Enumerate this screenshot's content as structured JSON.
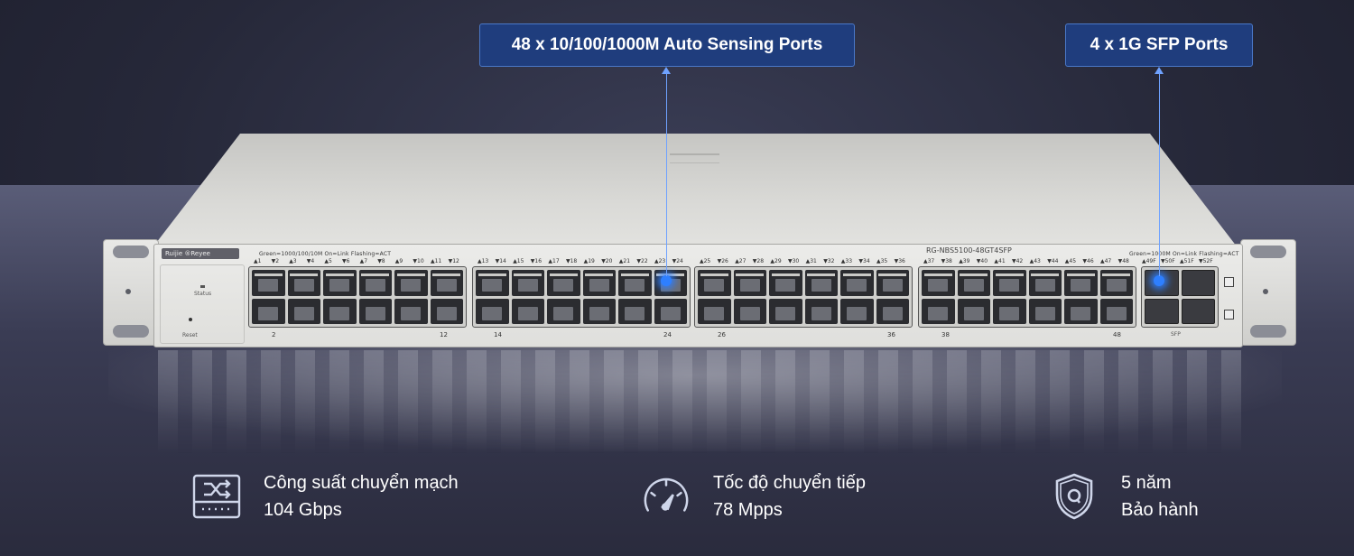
{
  "callouts": {
    "ports_label": "48 x 10/100/1000M Auto Sensing Ports",
    "sfp_label": "4 x 1G SFP Ports"
  },
  "device": {
    "brand": "Ruijie ®Reyee",
    "model": "RG-NBS5100-48GT4SFP",
    "legend_left": "Green=1000/100/10M   On=Link   Flashing=ACT",
    "legend_right": "Green=1000M   On=Link   Flashing=ACT",
    "status_label": "Status",
    "reset_label": "Reset",
    "sfp_label": "SFP",
    "port_numbers": {
      "g1": [
        "▲1",
        "▼2",
        "▲3",
        "▼4",
        "▲5",
        "▼6",
        "▲7",
        "▼8",
        "▲9",
        "▼10",
        "▲11",
        "▼12"
      ],
      "g2": [
        "▲13",
        "▼14",
        "▲15",
        "▼16",
        "▲17",
        "▼18",
        "▲19",
        "▼20",
        "▲21",
        "▼22",
        "▲23",
        "▼24"
      ],
      "g3": [
        "▲25",
        "▼26",
        "▲27",
        "▼28",
        "▲29",
        "▼30",
        "▲31",
        "▼32",
        "▲33",
        "▼34",
        "▲35",
        "▼36"
      ],
      "g4": [
        "▲37",
        "▼38",
        "▲39",
        "▼40",
        "▲41",
        "▼42",
        "▲43",
        "▼44",
        "▲45",
        "▼46",
        "▲47",
        "▼48"
      ],
      "sfp": [
        "▲49F",
        "▼50F",
        "▲51F",
        "▼52F"
      ]
    },
    "bottom_numbers": [
      "2",
      "12",
      "14",
      "24",
      "26",
      "36",
      "38",
      "48"
    ]
  },
  "specs": [
    {
      "icon": "switch-icon",
      "line1": "Công suất chuyển mạch",
      "line2": "104 Gbps"
    },
    {
      "icon": "speedometer-icon",
      "line1": "Tốc độ chuyển tiếp",
      "line2": "78 Mpps"
    },
    {
      "icon": "warranty-shield-icon",
      "line1": "5 năm",
      "line2": "Bảo hành"
    }
  ],
  "colors": {
    "callout_bg": "#1f3d7d",
    "highlight": "#2e7fff",
    "background": "#262839"
  }
}
